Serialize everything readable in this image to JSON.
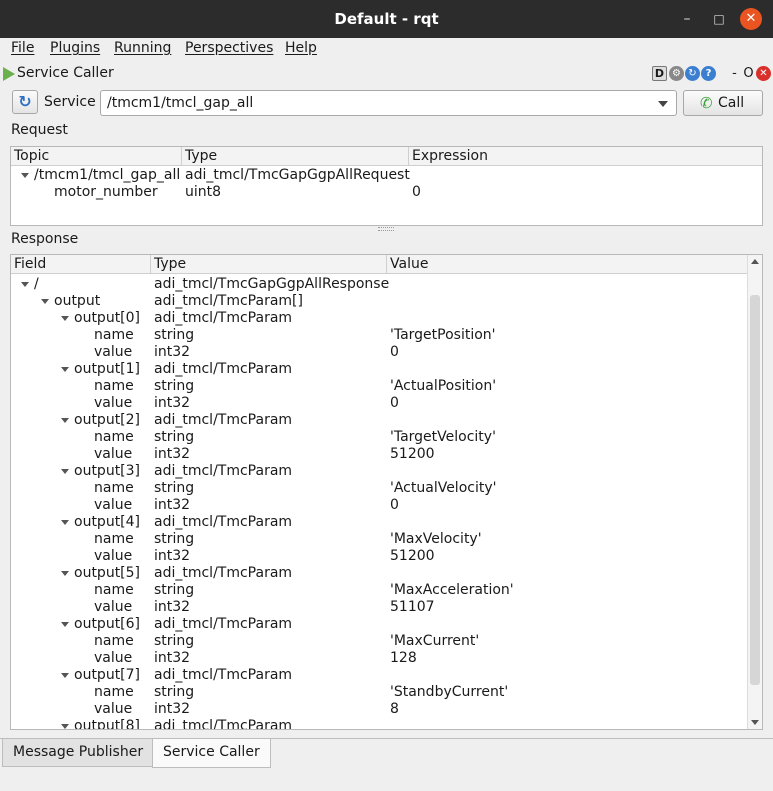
{
  "window": {
    "title": "Default - rqt",
    "min": "–",
    "max": "□",
    "close": "✕"
  },
  "menu": [
    "File",
    "Plugins",
    "Running",
    "Perspectives",
    "Help"
  ],
  "plugin": {
    "title": "Service Caller",
    "icons": {
      "d": "D",
      "gear": "⚙",
      "reload": "↻",
      "help": "?",
      "dash": "-",
      "o": "O",
      "close": "✕"
    }
  },
  "service": {
    "refresh_icon": "↻",
    "label": "Service",
    "value": "/tmcm1/tmcl_gap_all",
    "call_icon": "✆",
    "call_label": "Call"
  },
  "request": {
    "label": "Request",
    "columns": [
      "Topic",
      "Type",
      "Expression"
    ],
    "rows": [
      {
        "depth": 0,
        "expanded": true,
        "field": "/tmcm1/tmcl_gap_all",
        "type": "adi_tmcl/TmcGapGgpAllRequest",
        "value": ""
      },
      {
        "depth": 1,
        "expanded": false,
        "field": "motor_number",
        "type": "uint8",
        "value": "0"
      }
    ]
  },
  "response": {
    "label": "Response",
    "columns": [
      "Field",
      "Type",
      "Value"
    ],
    "rows": [
      {
        "depth": 0,
        "expanded": true,
        "field": "/",
        "type": "adi_tmcl/TmcGapGgpAllResponse",
        "value": ""
      },
      {
        "depth": 1,
        "expanded": true,
        "field": "output",
        "type": "adi_tmcl/TmcParam[]",
        "value": ""
      },
      {
        "depth": 2,
        "expanded": true,
        "field": "output[0]",
        "type": "adi_tmcl/TmcParam",
        "value": ""
      },
      {
        "depth": 3,
        "expanded": false,
        "field": "name",
        "type": "string",
        "value": "'TargetPosition'"
      },
      {
        "depth": 3,
        "expanded": false,
        "field": "value",
        "type": "int32",
        "value": "0"
      },
      {
        "depth": 2,
        "expanded": true,
        "field": "output[1]",
        "type": "adi_tmcl/TmcParam",
        "value": ""
      },
      {
        "depth": 3,
        "expanded": false,
        "field": "name",
        "type": "string",
        "value": "'ActualPosition'"
      },
      {
        "depth": 3,
        "expanded": false,
        "field": "value",
        "type": "int32",
        "value": "0"
      },
      {
        "depth": 2,
        "expanded": true,
        "field": "output[2]",
        "type": "adi_tmcl/TmcParam",
        "value": ""
      },
      {
        "depth": 3,
        "expanded": false,
        "field": "name",
        "type": "string",
        "value": "'TargetVelocity'"
      },
      {
        "depth": 3,
        "expanded": false,
        "field": "value",
        "type": "int32",
        "value": "51200"
      },
      {
        "depth": 2,
        "expanded": true,
        "field": "output[3]",
        "type": "adi_tmcl/TmcParam",
        "value": ""
      },
      {
        "depth": 3,
        "expanded": false,
        "field": "name",
        "type": "string",
        "value": "'ActualVelocity'"
      },
      {
        "depth": 3,
        "expanded": false,
        "field": "value",
        "type": "int32",
        "value": "0"
      },
      {
        "depth": 2,
        "expanded": true,
        "field": "output[4]",
        "type": "adi_tmcl/TmcParam",
        "value": ""
      },
      {
        "depth": 3,
        "expanded": false,
        "field": "name",
        "type": "string",
        "value": "'MaxVelocity'"
      },
      {
        "depth": 3,
        "expanded": false,
        "field": "value",
        "type": "int32",
        "value": "51200"
      },
      {
        "depth": 2,
        "expanded": true,
        "field": "output[5]",
        "type": "adi_tmcl/TmcParam",
        "value": ""
      },
      {
        "depth": 3,
        "expanded": false,
        "field": "name",
        "type": "string",
        "value": "'MaxAcceleration'"
      },
      {
        "depth": 3,
        "expanded": false,
        "field": "value",
        "type": "int32",
        "value": "51107"
      },
      {
        "depth": 2,
        "expanded": true,
        "field": "output[6]",
        "type": "adi_tmcl/TmcParam",
        "value": ""
      },
      {
        "depth": 3,
        "expanded": false,
        "field": "name",
        "type": "string",
        "value": "'MaxCurrent'"
      },
      {
        "depth": 3,
        "expanded": false,
        "field": "value",
        "type": "int32",
        "value": "128"
      },
      {
        "depth": 2,
        "expanded": true,
        "field": "output[7]",
        "type": "adi_tmcl/TmcParam",
        "value": ""
      },
      {
        "depth": 3,
        "expanded": false,
        "field": "name",
        "type": "string",
        "value": "'StandbyCurrent'"
      },
      {
        "depth": 3,
        "expanded": false,
        "field": "value",
        "type": "int32",
        "value": "8"
      },
      {
        "depth": 2,
        "expanded": true,
        "field": "output[8]",
        "type": "adi_tmcl/TmcParam",
        "value": ""
      }
    ]
  },
  "tabs": [
    "Message Publisher",
    "Service Caller"
  ],
  "active_tab": "Service Caller"
}
